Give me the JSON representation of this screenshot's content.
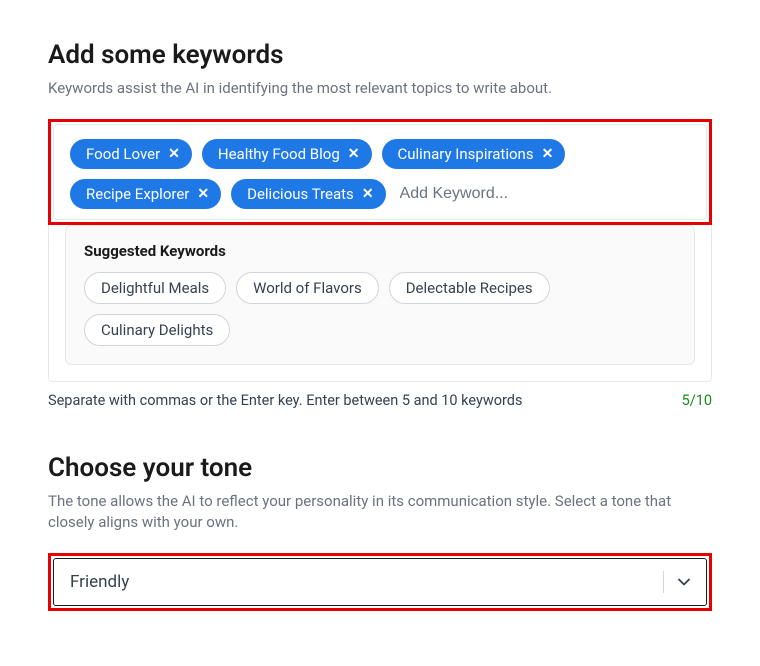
{
  "keywords_section": {
    "heading": "Add some keywords",
    "description": "Keywords assist the AI in identifying the most relevant topics to write about.",
    "selected_keywords": [
      "Food Lover",
      "Healthy Food Blog",
      "Culinary Inspirations",
      "Recipe Explorer",
      "Delicious Treats"
    ],
    "add_placeholder": "Add Keyword...",
    "suggested_heading": "Suggested Keywords",
    "suggested_keywords": [
      "Delightful Meals",
      "World of Flavors",
      "Delectable Recipes",
      "Culinary Delights"
    ],
    "helper_text": "Separate with commas or the Enter key. Enter between 5 and 10 keywords",
    "count_display": "5/10"
  },
  "tone_section": {
    "heading": "Choose your tone",
    "description": "The tone allows the AI to reflect your personality in its communication style. Select a tone that closely aligns with your own.",
    "selected_tone": "Friendly"
  },
  "colors": {
    "pill_bg": "#1e78e6",
    "highlight": "#e60000",
    "count_ok": "#1a8a1a"
  }
}
